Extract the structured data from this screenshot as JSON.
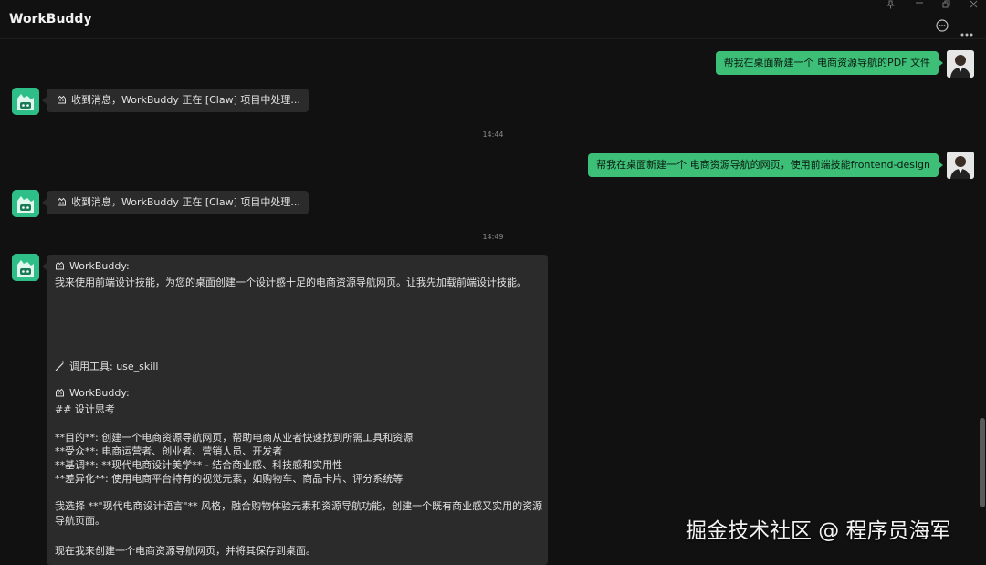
{
  "app": {
    "title": "WorkBuddy"
  },
  "header": {
    "chat_icon": "chat-bubble-icon",
    "more_icon": "more-horizontal-icon"
  },
  "window_controls": {
    "pin_icon": "pin-icon",
    "restore_icon": "restore-icon",
    "close_icon": "close-icon"
  },
  "messages": {
    "user1": "帮我在桌面新建一个 电商资源导航的PDF 文件",
    "bot1": "收到消息，WorkBuddy 正在 [Claw] 项目中处理...",
    "time1": "14:44",
    "user2": "帮我在桌面新建一个 电商资源导航的网页，使用前端技能frontend-design",
    "bot2": "收到消息，WorkBuddy 正在 [Claw] 项目中处理...",
    "time2": "14:49"
  },
  "reply": {
    "sender1": "WorkBuddy:",
    "intro": "我来使用前端设计技能，为您的桌面创建一个设计感十足的电商资源导航网页。让我先加载前端设计技能。",
    "tool_call": "调用工具: use_skill",
    "sender2": "WorkBuddy:",
    "heading": "## 设计思考",
    "goal": "**目的**: 创建一个电商资源导航网页，帮助电商从业者快速找到所需工具和资源",
    "audience": "**受众**: 电商运营者、创业者、营销人员、开发者",
    "tone": "**基调**: **现代电商设计美学** - 结合商业感、科技感和实用性",
    "diff": "**差异化**: 使用电商平台特有的视觉元素，如购物车、商品卡片、评分系统等",
    "choice": "我选择 **\"现代电商设计语言\"** 风格，融合购物体验元素和资源导航功能，创建一个既有商业感又实用的资源导航页面。",
    "final": "现在我来创建一个电商资源导航网页，并将其保存到桌面。"
  },
  "watermark": "掘金技术社区 @ 程序员海军",
  "colors": {
    "accent": "#3dbf78",
    "bot_avatar": "#2dbf87",
    "background": "#111111",
    "bubble": "#2b2b2b"
  }
}
